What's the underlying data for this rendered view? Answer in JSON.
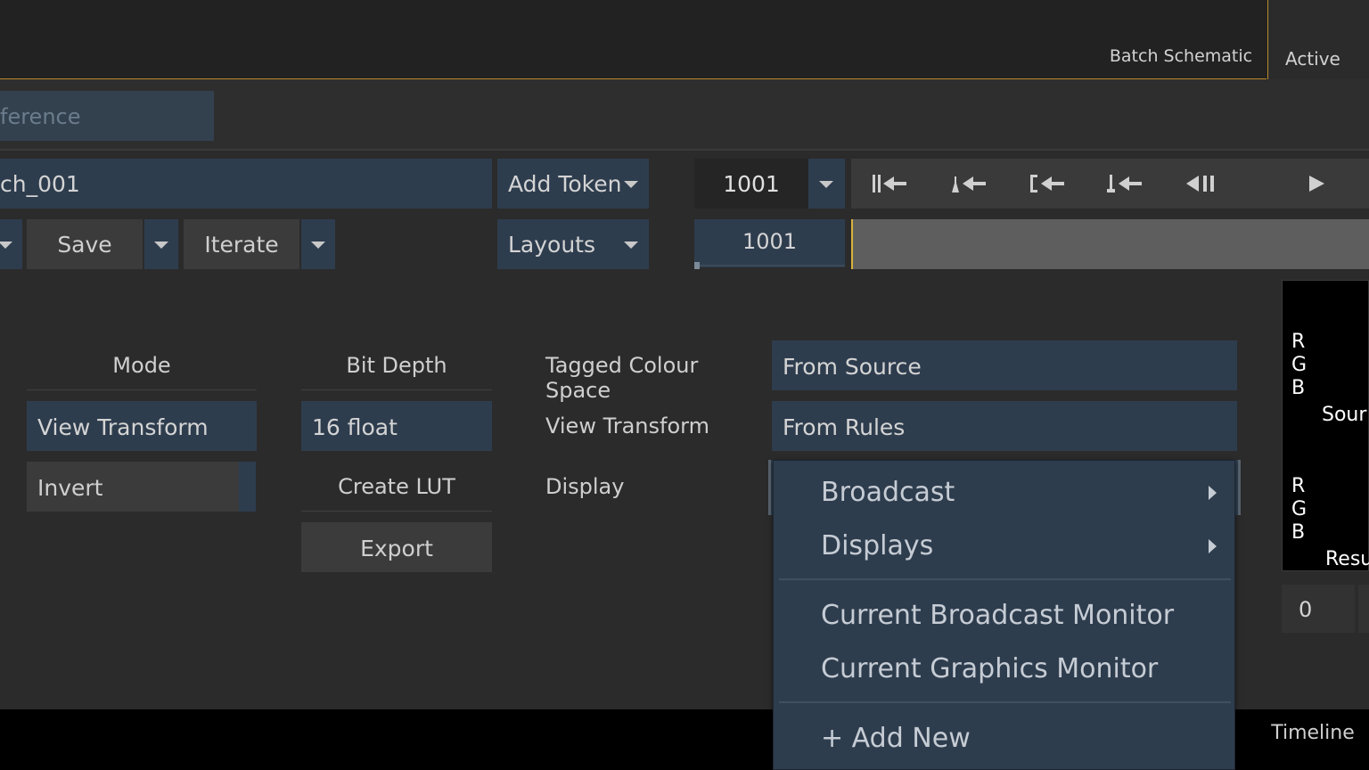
{
  "top_tabs": {
    "batch": "Batch Schematic",
    "active": "Active"
  },
  "reference_field": "ference",
  "toolbar": {
    "name_value": "ch_001",
    "add_token": "Add Token",
    "save": "Save",
    "iterate": "Iterate",
    "layouts": "Layouts"
  },
  "transport": {
    "frame": "1001",
    "frame2": "1001",
    "buttons": [
      "go-to-start-icon",
      "previous-keyframe-icon",
      "go-to-in-icon",
      "previous-marker-icon",
      "step-back-icon",
      "play-icon"
    ]
  },
  "settings": {
    "mode_label": "Mode",
    "mode_value": "View Transform",
    "invert": "Invert",
    "bit_depth_label": "Bit Depth",
    "bit_depth_value": "16 float",
    "create_lut": "Create LUT",
    "export": "Export",
    "tagged_label": "Tagged Colour Space",
    "tagged_value": "From Source",
    "view_transform_label": "View Transform",
    "view_transform_value": "From Rules",
    "display_label": "Display"
  },
  "viewer": {
    "rgb_top": [
      "R",
      "G",
      "B"
    ],
    "source_label": "Sour",
    "rgb_bottom": [
      "R",
      "G",
      "B"
    ],
    "result_label": "Resu",
    "value": "0"
  },
  "display_menu": {
    "items": [
      {
        "label": "Broadcast",
        "submenu": true
      },
      {
        "label": "Displays",
        "submenu": true
      },
      {
        "label": "Current Broadcast Monitor",
        "submenu": false
      },
      {
        "label": "Current Graphics Monitor",
        "submenu": false
      },
      {
        "label": "+ Add New",
        "submenu": false
      }
    ]
  },
  "bottom": {
    "timeline": "Timeline"
  },
  "colors": {
    "field": "#2e3d4e",
    "accent": "#b8892a",
    "cursor": "#d8b23a"
  }
}
